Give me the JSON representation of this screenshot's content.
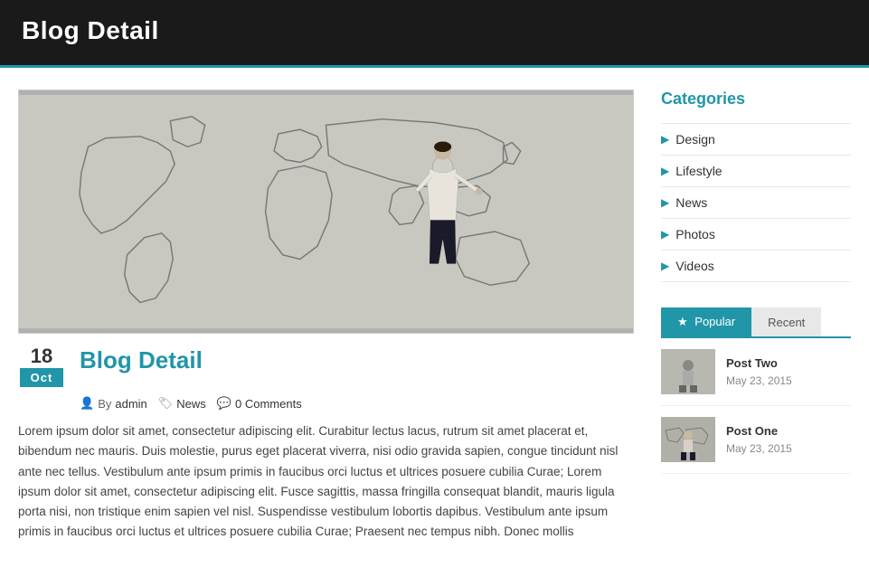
{
  "header": {
    "title": "Blog Detail"
  },
  "main": {
    "post": {
      "day": "18",
      "month": "Oct",
      "title": "Blog Detail",
      "author": "admin",
      "category": "News",
      "comments": "0 Comments",
      "body": "Lorem ipsum dolor sit amet, consectetur adipiscing elit. Curabitur lectus lacus, rutrum sit amet placerat et, bibendum nec mauris. Duis molestie, purus eget placerat viverra, nisi odio gravida sapien, congue tincidunt nisl ante nec tellus. Vestibulum ante ipsum primis in faucibus orci luctus et ultrices posuere cubilia Curae; Lorem ipsum dolor sit amet, consectetur adipiscing elit. Fusce sagittis, massa fringilla consequat blandit, mauris ligula porta nisi, non tristique enim sapien vel nisl. Suspendisse vestibulum lobortis dapibus. Vestibulum ante ipsum primis in faucibus orci luctus et ultrices posuere cubilia Curae; Praesent nec tempus nibh. Donec mollis"
    }
  },
  "sidebar": {
    "categories_title": "Categories",
    "categories": [
      {
        "label": "Design"
      },
      {
        "label": "Lifestyle"
      },
      {
        "label": "News"
      },
      {
        "label": "Photos"
      },
      {
        "label": "Videos"
      }
    ],
    "tabs": [
      {
        "label": "Popular",
        "active": true,
        "icon": "★"
      },
      {
        "label": "Recent",
        "active": false
      }
    ],
    "popular_posts": [
      {
        "title": "Post Two",
        "date": "May 23, 2015"
      },
      {
        "title": "Post One",
        "date": "May 23, 2015"
      }
    ]
  }
}
